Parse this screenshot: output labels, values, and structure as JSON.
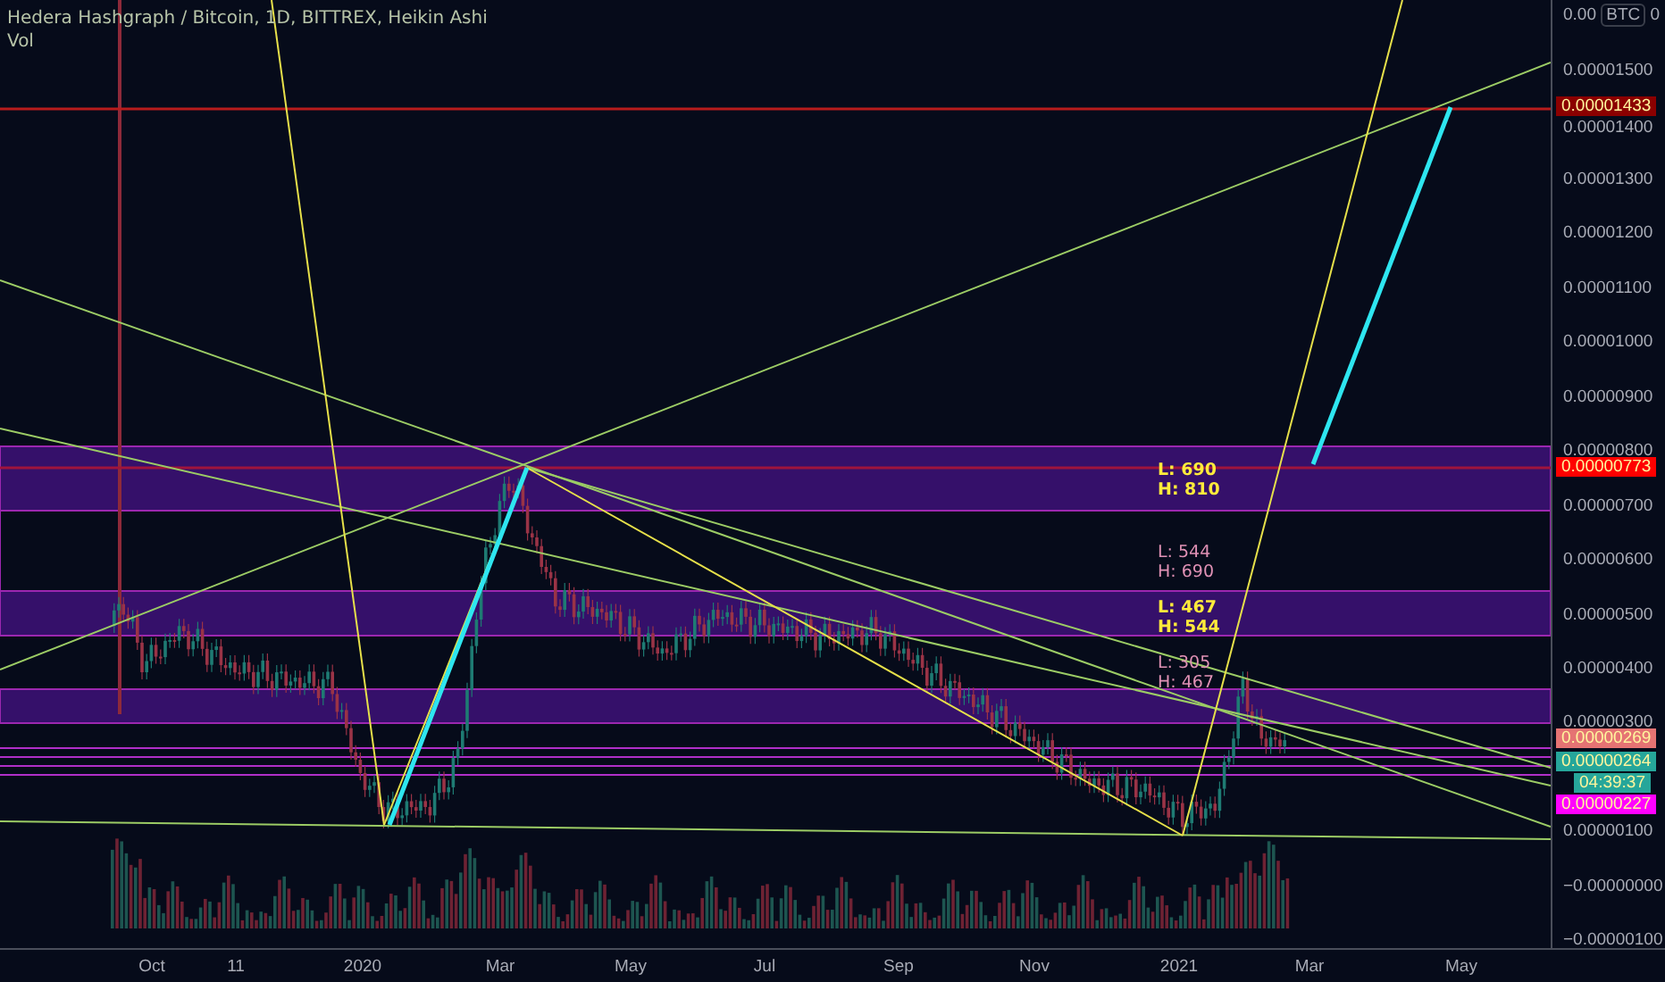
{
  "legend": {
    "title": "Hedera Hashgraph / Bitcoin, 1D, BITTREX, Heikin Ashi",
    "volume": "Vol"
  },
  "price_axis": {
    "header": {
      "value": "0.00",
      "unit": "BTC",
      "end": "0"
    },
    "labels": [
      "0.00001500",
      "0.00001400",
      "0.00001300",
      "0.00001200",
      "0.00001100",
      "0.00001000",
      "0.00000900",
      "0.00000800",
      "0.00000700",
      "0.00000600",
      "0.00000500",
      "0.00000400",
      "0.00000300",
      "0.00000100",
      "−0.00000000",
      "−0.00000100"
    ],
    "tags": [
      {
        "text": "0.00001433",
        "color": "#8b0000"
      },
      {
        "text": "0.00000773",
        "color": "#ff0000"
      },
      {
        "text": "0.00000269",
        "color": "#e57373"
      },
      {
        "text": "0.00000264",
        "color": "#26a69a"
      },
      {
        "text": "04:39:37",
        "color": "#26a69a"
      },
      {
        "text": "0.00000227",
        "color": "#ff00ff"
      }
    ]
  },
  "zones": [
    {
      "low": "L: 690",
      "high": "H: 810",
      "emphasis": true
    },
    {
      "low": "L: 544",
      "high": "H: 690",
      "emphasis": false
    },
    {
      "low": "L: 467",
      "high": "H: 544",
      "emphasis": true
    },
    {
      "low": "L: 305",
      "high": "H: 467",
      "emphasis": false
    }
  ],
  "time_axis": [
    "Oct",
    "11",
    "2020",
    "Mar",
    "May",
    "Jul",
    "Sep",
    "Nov",
    "2021",
    "Mar",
    "May"
  ]
}
